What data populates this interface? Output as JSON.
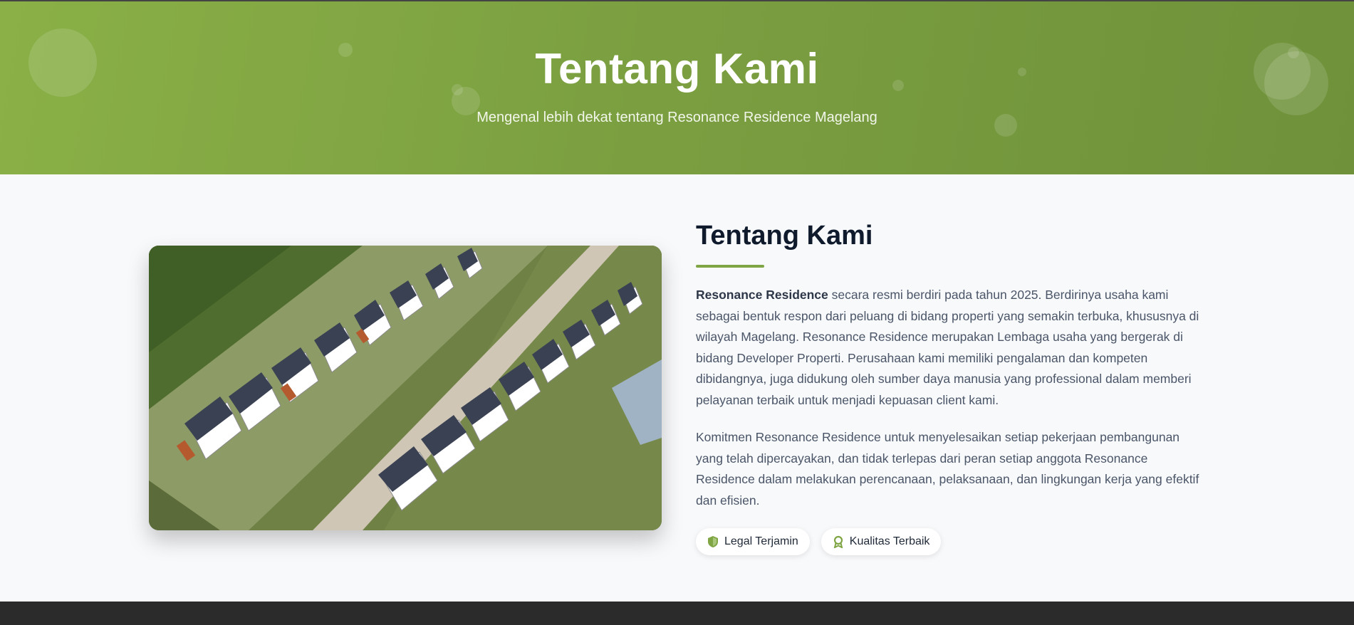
{
  "hero": {
    "title": "Tentang Kami",
    "subtitle": "Mengenal lebih dekat tentang Resonance Residence Magelang"
  },
  "about": {
    "title": "Tentang Kami",
    "image_alt": "Aerial view of row houses at Resonance Residence",
    "paragraph1_brand": "Resonance Residence",
    "paragraph1_rest": " secara resmi berdiri pada tahun 2025. Berdirinya usaha kami sebagai bentuk respon dari peluang di bidang properti yang semakin terbuka, khususnya di wilayah Magelang. Resonance Residence merupakan Lembaga usaha yang bergerak di bidang Developer Properti. Perusahaan kami memiliki pengalaman dan kompeten dibidangnya, juga didukung oleh sumber daya manusia yang professional dalam memberi pelayanan terbaik untuk menjadi kepuasan client kami.",
    "paragraph2": "Komitmen Resonance Residence untuk menyelesaikan setiap pekerjaan pembangunan yang telah dipercayakan, dan tidak terlepas dari peran setiap anggota Resonance Residence dalam melakukan perencanaan, pelaksanaan, dan lingkungan kerja yang efektif dan efisien.",
    "badges": [
      {
        "label": "Legal Terjamin",
        "icon": "shield-icon"
      },
      {
        "label": "Kualitas Terbaik",
        "icon": "award-icon"
      }
    ]
  },
  "colors": {
    "accent": "#7fa544",
    "hero_start": "#8ab047",
    "hero_end": "#6f913a",
    "heading": "#0f1b2d",
    "body_text": "#4a5568"
  }
}
